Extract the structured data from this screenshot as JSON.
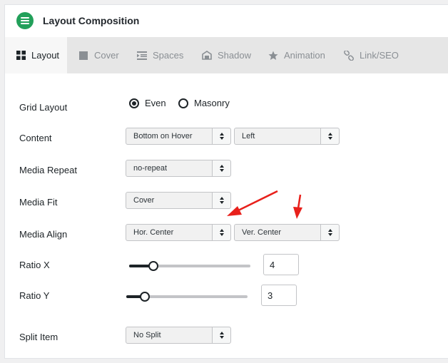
{
  "header": {
    "title": "Layout Composition",
    "icon": "menu-icon",
    "accent": "#22a05a"
  },
  "tabs": [
    {
      "label": "Layout",
      "icon": "grid-icon",
      "active": true
    },
    {
      "label": "Cover",
      "icon": "square-icon",
      "active": false
    },
    {
      "label": "Spaces",
      "icon": "spacing-icon",
      "active": false
    },
    {
      "label": "Shadow",
      "icon": "shadow-icon",
      "active": false
    },
    {
      "label": "Animation",
      "icon": "star-icon",
      "active": false
    },
    {
      "label": "Link/SEO",
      "icon": "link-icon",
      "active": false
    }
  ],
  "form": {
    "grid_layout": {
      "label": "Grid Layout",
      "options": [
        "Even",
        "Masonry"
      ],
      "selected": "Even"
    },
    "content": {
      "label": "Content",
      "select1": "Bottom on Hover",
      "select2": "Left"
    },
    "media_repeat": {
      "label": "Media Repeat",
      "value": "no-repeat"
    },
    "media_fit": {
      "label": "Media Fit",
      "value": "Cover"
    },
    "media_align": {
      "label": "Media Align",
      "horizontal": "Hor. Center",
      "vertical": "Ver. Center"
    },
    "ratio_x": {
      "label": "Ratio X",
      "value": "4",
      "slider_fraction": 0.2
    },
    "ratio_y": {
      "label": "Ratio Y",
      "value": "3",
      "slider_fraction": 0.15
    },
    "split_item": {
      "label": "Split Item",
      "value": "No Split"
    }
  },
  "annotation_color": "#e8201b"
}
